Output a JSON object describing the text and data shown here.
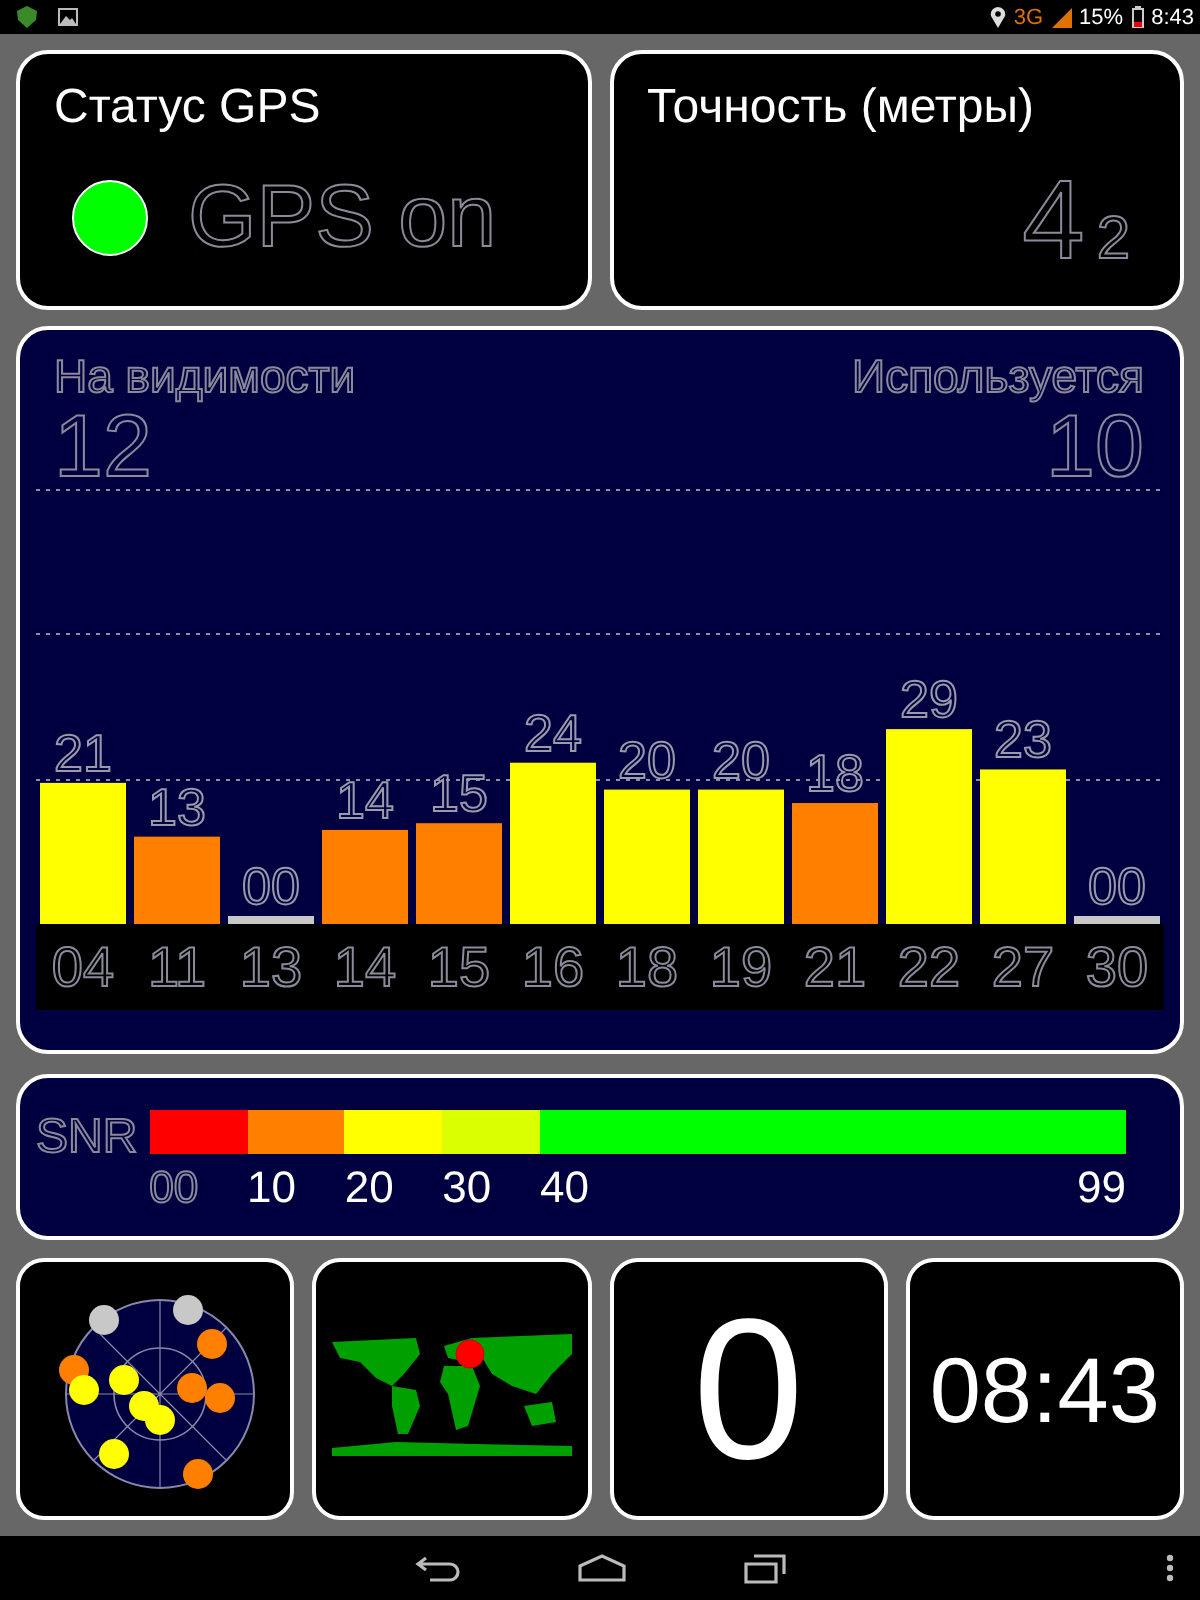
{
  "status_bar": {
    "network": "3G",
    "battery": "15%",
    "time": "8:43"
  },
  "gps_status": {
    "title": "Статус GPS",
    "on": true,
    "text": "GPS on"
  },
  "accuracy": {
    "title": "Точность (метры)",
    "value": "4",
    "decimal": "2"
  },
  "satellites": {
    "visible_label": "На видимости",
    "visible_count": "12",
    "used_label": "Используется",
    "used_count": "10",
    "chart_data": {
      "type": "bar",
      "categories": [
        "04",
        "11",
        "13",
        "14",
        "15",
        "16",
        "18",
        "19",
        "21",
        "22",
        "27",
        "30"
      ],
      "values": [
        21,
        13,
        0,
        14,
        15,
        24,
        20,
        20,
        18,
        29,
        23,
        0
      ],
      "value_labels": [
        "21",
        "13",
        "00",
        "14",
        "15",
        "24",
        "20",
        "20",
        "18",
        "29",
        "23",
        "00"
      ]
    }
  },
  "snr": {
    "label": "SNR",
    "segments": [
      {
        "label": "00",
        "color": "#ff0000",
        "dim": true
      },
      {
        "label": "10",
        "color": "#ff8000",
        "dim": false
      },
      {
        "label": "20",
        "color": "#ffff00",
        "dim": false
      },
      {
        "label": "30",
        "color": "#d9ff00",
        "dim": false
      },
      {
        "label": "40",
        "color": "#00ff00",
        "dim": false
      }
    ],
    "end_label": "99"
  },
  "speed": {
    "value": "0"
  },
  "clock": {
    "time": "08:43"
  }
}
